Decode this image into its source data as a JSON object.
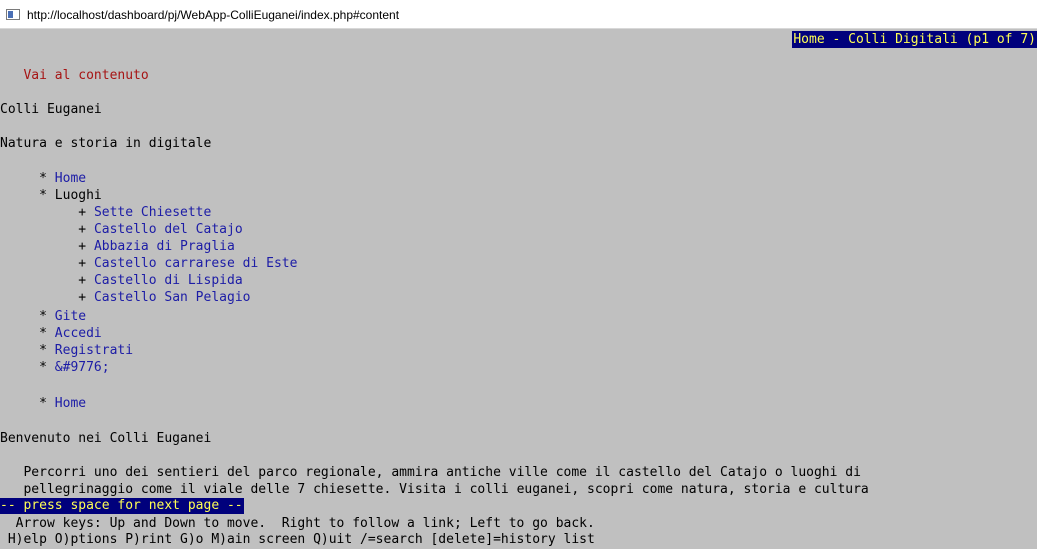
{
  "window": {
    "title": "http://localhost/dashboard/pj/WebApp-ColliEuganei/index.php#content"
  },
  "header": {
    "page_title": "Home - Colli Digitali (p1 of 7)"
  },
  "content": {
    "skip_link": "Vai al contenuto",
    "site_title": "Colli Euganei",
    "tagline": "Natura e storia in digitale",
    "bullet": "*",
    "sub_bullet": "+",
    "nav": {
      "home": "Home",
      "luoghi": "Luoghi",
      "luoghi_items": [
        "Sette Chiesette",
        "Castello del Catajo",
        "Abbazia di Praglia",
        "Castello carrarese di Este",
        "Castello di Lispida",
        "Castello San Pelagio"
      ],
      "gite": "Gite",
      "accedi": "Accedi",
      "registrati": "Registrati",
      "menu_entity": "&#9776;"
    },
    "breadcrumb_home": "Home",
    "welcome_heading": "Benvenuto nei Colli Euganei",
    "intro_line1": "Percorri uno dei sentieri del parco regionale, ammira antiche ville come il castello del Catajo o luoghi di",
    "intro_line2": "pellegrinaggio come il viale delle 7 chiesette. Visita i colli euganei, scopri come natura, storia e cultura"
  },
  "footer": {
    "status": "-- press space for next page --",
    "help_line1": "  Arrow keys: Up and Down to move.  Right to follow a link; Left to go back.",
    "help_line2": " H)elp O)ptions P)rint G)o M)ain screen Q)uit /=search [delete]=history list"
  }
}
